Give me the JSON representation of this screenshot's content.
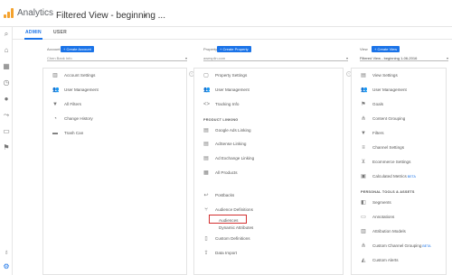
{
  "header": {
    "app_name": "Analytics",
    "view_title": "Filtered View - beginning ...",
    "caret": "▾"
  },
  "tabs": [
    {
      "label": "ADMIN"
    },
    {
      "label": "USER"
    }
  ],
  "account": {
    "heading": "Account",
    "create_label": "+ Create Account",
    "selected": "Chen Bank Info",
    "items": [
      {
        "label": "Account Settings"
      },
      {
        "label": "User Management"
      },
      {
        "label": "All Filters"
      },
      {
        "label": "Change History"
      },
      {
        "label": "Trash Can"
      }
    ]
  },
  "property": {
    "heading": "Property",
    "create_label": "+ Create Property",
    "selected": "awesplin.com",
    "items": [
      {
        "label": "Property Settings"
      },
      {
        "label": "User Management"
      },
      {
        "label": "Tracking Info"
      }
    ],
    "product_linking_label": "PRODUCT LINKING",
    "linking_items": [
      {
        "label": "Google Ads Linking"
      },
      {
        "label": "AdSense Linking"
      },
      {
        "label": "Ad Exchange Linking"
      },
      {
        "label": "All Products"
      }
    ],
    "more_items": [
      {
        "label": "Postbacks"
      },
      {
        "label": "Audience Definitions"
      }
    ],
    "sub_items": [
      {
        "label": "Audiences"
      },
      {
        "label": "Dynamic Attributes"
      }
    ],
    "tail_items": [
      {
        "label": "Custom Definitions"
      },
      {
        "label": "Data Import"
      }
    ]
  },
  "view": {
    "heading": "View",
    "create_label": "+ Create View",
    "selected": "Filtered View - beginning 1-06-2016",
    "items": [
      {
        "label": "View Settings"
      },
      {
        "label": "User Management"
      },
      {
        "label": "Goals"
      },
      {
        "label": "Content Grouping"
      },
      {
        "label": "Filters"
      },
      {
        "label": "Channel Settings"
      },
      {
        "label": "Ecommerce Settings"
      },
      {
        "label": "Calculated Metrics",
        "badge": "BETA"
      }
    ],
    "personal_label": "PERSONAL TOOLS & ASSETS",
    "personal_items": [
      {
        "label": "Segments"
      },
      {
        "label": "Annotations"
      },
      {
        "label": "Attribution Models"
      },
      {
        "label": "Custom Channel Grouping",
        "badge": "BETA"
      },
      {
        "label": "Custom Alerts"
      }
    ]
  }
}
